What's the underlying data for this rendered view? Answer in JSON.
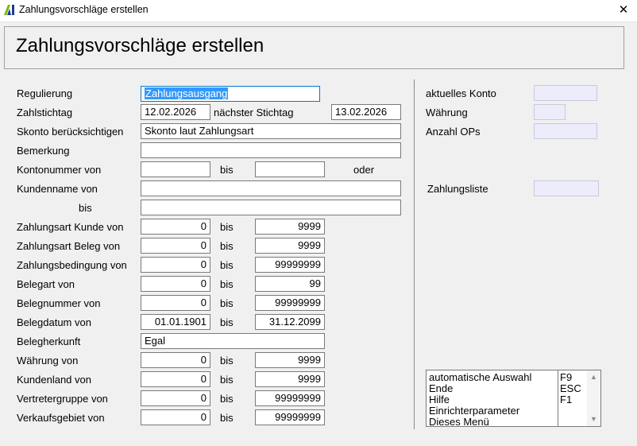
{
  "window": {
    "title": "Zahlungsvorschläge erstellen",
    "close_glyph": "✕"
  },
  "header": {
    "title": "Zahlungsvorschläge erstellen"
  },
  "form": {
    "regulierung": {
      "label": "Regulierung",
      "value": "Zahlungsausgang"
    },
    "zahlstichtag": {
      "label": "Zahlstichtag",
      "value": "12.02.2026"
    },
    "naechster_stichtag": {
      "label": "nächster Stichtag",
      "value": "13.02.2026"
    },
    "skonto": {
      "label": "Skonto berücksichtigen",
      "value": "Skonto laut Zahlungsart"
    },
    "bemerkung": {
      "label": "Bemerkung",
      "value": ""
    },
    "kontonummer": {
      "label": "Kontonummer von",
      "from": "",
      "to": "",
      "oder": "oder"
    },
    "kundenname": {
      "label": "Kundenname von",
      "bis_label": "bis",
      "from": "",
      "to": ""
    },
    "ranges": [
      {
        "label": "Zahlungsart Kunde von",
        "from": "0",
        "to": "9999"
      },
      {
        "label": "Zahlungsart Beleg von",
        "from": "0",
        "to": "9999"
      },
      {
        "label": "Zahlungsbedingung von",
        "from": "0",
        "to": "99999999"
      },
      {
        "label": "Belegart von",
        "from": "0",
        "to": "99"
      },
      {
        "label": "Belegnummer von",
        "from": "0",
        "to": "99999999"
      },
      {
        "label": "Belegdatum von",
        "from": "01.01.1901",
        "to": "31.12.2099"
      }
    ],
    "belegherkunft": {
      "label": "Belegherkunft",
      "value": "Egal"
    },
    "ranges2": [
      {
        "label": "Währung von",
        "from": "0",
        "to": "9999"
      },
      {
        "label": "Kundenland von",
        "from": "0",
        "to": "9999"
      },
      {
        "label": "Vertretergruppe von",
        "from": "0",
        "to": "99999999"
      },
      {
        "label": "Verkaufsgebiet von",
        "from": "0",
        "to": "99999999"
      }
    ],
    "bis": "bis"
  },
  "info": {
    "aktuelles_konto": {
      "label": "aktuelles Konto",
      "value": ""
    },
    "waehrung": {
      "label": "Währung",
      "value": ""
    },
    "anzahl_ops": {
      "label": "Anzahl OPs",
      "value": ""
    },
    "zahlungsliste": {
      "label": "Zahlungsliste",
      "value": ""
    }
  },
  "menu": {
    "items": [
      {
        "label": "automatische Auswahl",
        "key": "F9"
      },
      {
        "label": "Ende",
        "key": "ESC"
      },
      {
        "label": "Hilfe",
        "key": "F1"
      },
      {
        "label": "Einrichterparameter",
        "key": ""
      },
      {
        "label": "Dieses Menü",
        "key": ""
      }
    ]
  },
  "colors": {
    "logo_green": "#7ab800",
    "logo_blue": "#1a3b8c",
    "selection": "#3399ff",
    "readonly_bg": "#ececfb"
  }
}
